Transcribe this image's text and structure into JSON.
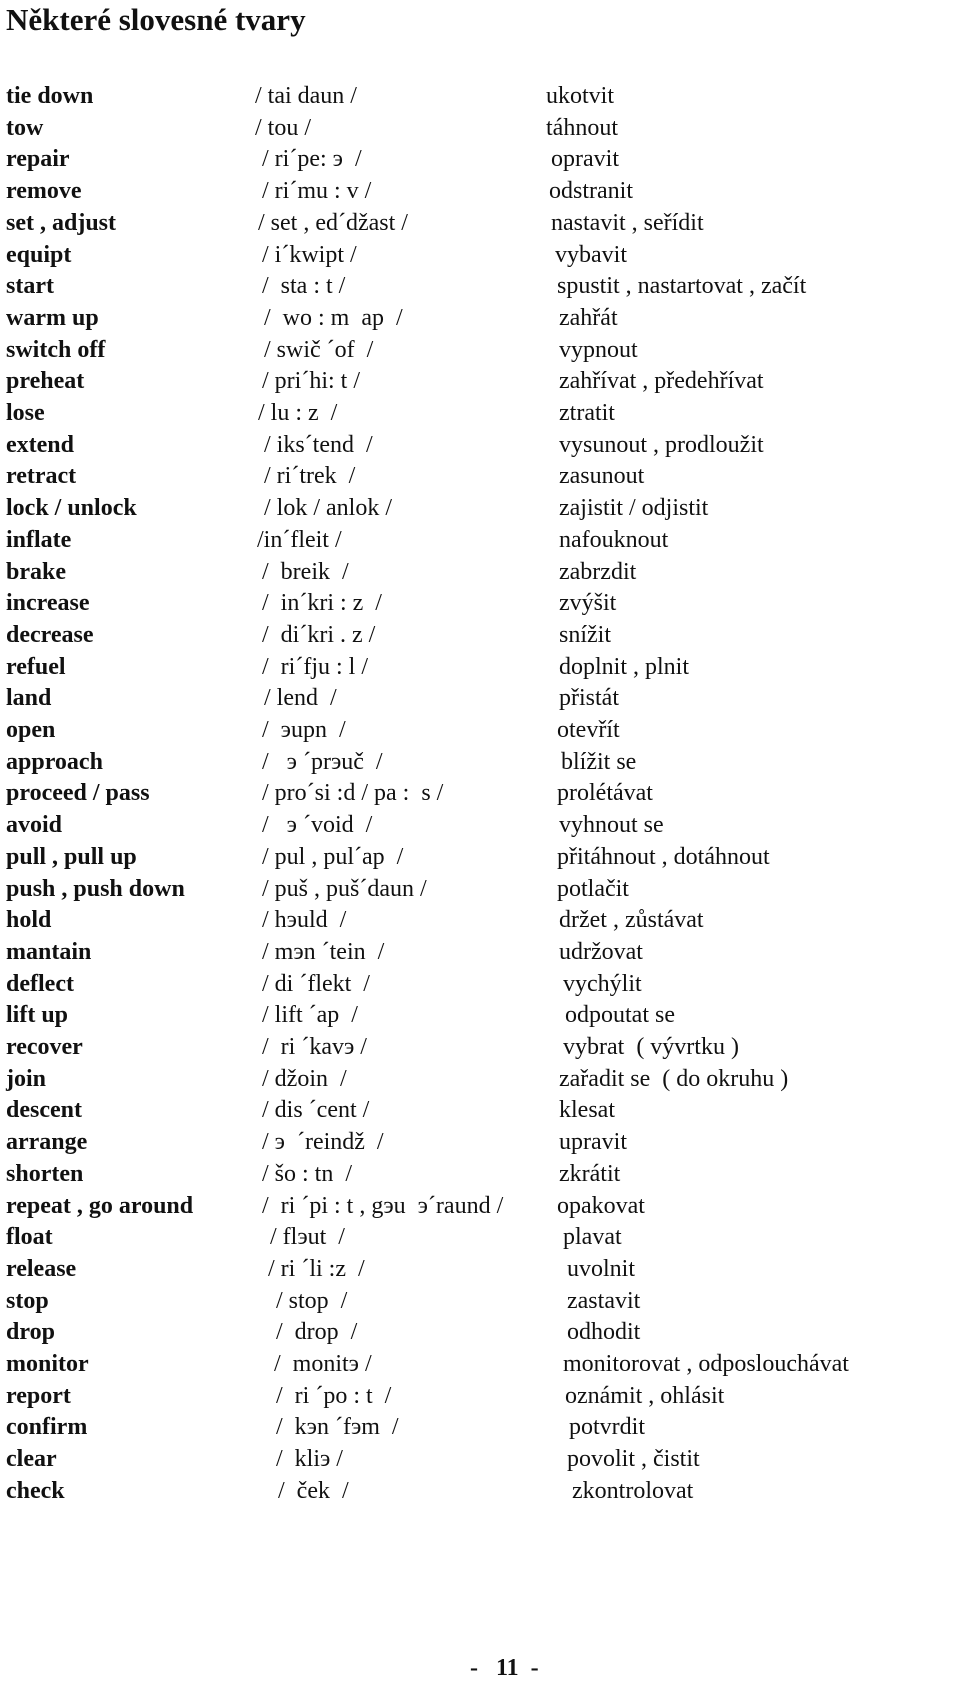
{
  "page": {
    "title": "Některé slovesné tvary",
    "page_number": "-   11  -"
  },
  "entries": [
    {
      "term": "tie down",
      "pron": "/ tai daun /",
      "trans": "ukotvit"
    },
    {
      "term": "tow",
      "pron": "/ tou /",
      "trans": "táhnout"
    },
    {
      "term": "repair",
      "pron": "/ ri´pe: э  /",
      "trans": "opravit"
    },
    {
      "term": "remove",
      "pron": "/ ri´mu : v /",
      "trans": "odstranit"
    },
    {
      "term": "set , adjust",
      "pron": "/ set , ed´džast /",
      "trans": "nastavit , seřídit"
    },
    {
      "term": "equipt",
      "pron": "/ i´kwipt /",
      "trans": "vybavit"
    },
    {
      "term": "start",
      "pron": "/  sta : t /",
      "trans": "spustit , nastartovat , začít"
    },
    {
      "term": "warm up",
      "pron": "/  wo : m  ap  /",
      "trans": "zahřát"
    },
    {
      "term": "switch off",
      "pron": "/ swič ´of  /",
      "trans": "vypnout"
    },
    {
      "term": "preheat",
      "pron": "/ pri´hi: t /",
      "trans": "zahřívat , předehřívat"
    },
    {
      "term": "lose",
      "pron": "/ lu : z  /",
      "trans": "ztratit"
    },
    {
      "term": "extend",
      "pron": "/ iks´tend  /",
      "trans": "vysunout , prodloužit"
    },
    {
      "term": "retract",
      "pron": "/ ri´trek  /",
      "trans": "zasunout"
    },
    {
      "term": "lock / unlock",
      "pron": "/ lok / anlok /",
      "trans": "zajistit / odjistit"
    },
    {
      "term": "inflate",
      "pron": "/in´fleit /",
      "trans": "nafouknout"
    },
    {
      "term": "brake",
      "pron": "/  breik  /",
      "trans": "zabrzdit"
    },
    {
      "term": "increase",
      "pron": "/  in´kri : z  /",
      "trans": "zvýšit"
    },
    {
      "term": "decrease",
      "pron": "/  di´kri . z /",
      "trans": "snížit"
    },
    {
      "term": "refuel",
      "pron": "/  ri´fju : l /",
      "trans": "doplnit , plnit"
    },
    {
      "term": "land",
      "pron": "/ lend  /",
      "trans": "přistát"
    },
    {
      "term": "open",
      "pron": "/  эupn  /",
      "trans": "otevřít"
    },
    {
      "term": "approach",
      "pron": "/   э ´prэuč  /",
      "trans": "blížit se"
    },
    {
      "term": "proceed / pass",
      "pron": "/ pro´si :d / pa :  s /",
      "trans": "prolétávat"
    },
    {
      "term": "avoid",
      "pron": "/   э ´void  /",
      "trans": "vyhnout se"
    },
    {
      "term": "pull , pull up",
      "pron": "/ pul , pul´ap  /",
      "trans": "přitáhnout , dotáhnout"
    },
    {
      "term": "push , push down",
      "pron": "/ puš , puš´daun /",
      "trans": "potlačit"
    },
    {
      "term": "hold",
      "pron": "/ hэuld  /",
      "trans": "držet , zůstávat"
    },
    {
      "term": "mantain",
      "pron": "/ mэn ´tein  /",
      "trans": "udržovat"
    },
    {
      "term": "deflect",
      "pron": "/ di ´flekt  /",
      "trans": "vychýlit"
    },
    {
      "term": "lift up",
      "pron": "/ lift ´ap  /",
      "trans": "odpoutat se"
    },
    {
      "term": "recover",
      "pron": "/  ri ´kavэ /",
      "trans": "vybrat  ( vývrtku )"
    },
    {
      "term": "join",
      "pron": "/ džoin  /",
      "trans": "zařadit se  ( do okruhu )"
    },
    {
      "term": "descent",
      "pron": "/ dis ´cent /",
      "trans": "klesat"
    },
    {
      "term": "arrange",
      "pron": "/ э  ´reindž  /",
      "trans": "upravit"
    },
    {
      "term": "shorten",
      "pron": "/ šo : tn  /",
      "trans": "zkrátit"
    },
    {
      "term": "repeat , go around",
      "pron": "/  ri ´pi : t , gэu  э´raund /",
      "trans": "opakovat"
    },
    {
      "term": "float",
      "pron": "/ flэut  /",
      "trans": "plavat"
    },
    {
      "term": "release",
      "pron": "/ ri ´li :z  /",
      "trans": "uvolnit"
    },
    {
      "term": "stop",
      "pron": "/ stop  /",
      "trans": "zastavit"
    },
    {
      "term": "drop",
      "pron": "/  drop  /",
      "trans": "odhodit"
    },
    {
      "term": "monitor",
      "pron": "/  monitэ /",
      "trans": "monitorovat , odposlouchávat"
    },
    {
      "term": "report",
      "pron": "/  ri ´po : t  /",
      "trans": "oznámit , ohlásit"
    },
    {
      "term": "confirm",
      "pron": "/  kэn ´fэm  /",
      "trans": "potvrdit"
    },
    {
      "term": "clear",
      "pron": "/  kliэ /",
      "trans": "povolit , čistit"
    },
    {
      "term": "check",
      "pron": "/  ček  /",
      "trans": "zkontrolovat"
    }
  ]
}
